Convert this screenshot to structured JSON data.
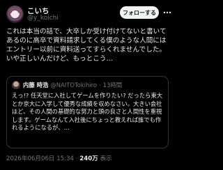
{
  "author": {
    "display_name": "こいち",
    "handle": "@y_koichi",
    "avatar_icon": "user-avatar"
  },
  "follow_button": {
    "label": "フォローする"
  },
  "more_icon": "more-options-icon",
  "tweet": {
    "text": "これは本当の話で、大卒しか受け付けてないと書いてあるのに高卒で資料請求してくる僕のような人間にはエントリー以前に資料送ってすらくれませんでした。いや正しいんだけど、もっとこう…"
  },
  "quote": {
    "name": "内藤 時浩",
    "handle": "@NAITOTokihiro",
    "separator": "·",
    "time": "13時間",
    "text": "えっ!? 任天堂に入社してゲームを作りたい? だったら東大とか京大に入学して優秀な成績を収めなさい。大きい会社ほど、その人間の基礎的な努力と頭の良さと人間性を重視します。ゲームなんて入社後にちょっと教えれば誰でも作れるようになるが、…"
  },
  "meta": {
    "timestamp": "2026年06月06日 15:34",
    "separator": "·",
    "views_count": "240万",
    "views_label": "表示"
  }
}
